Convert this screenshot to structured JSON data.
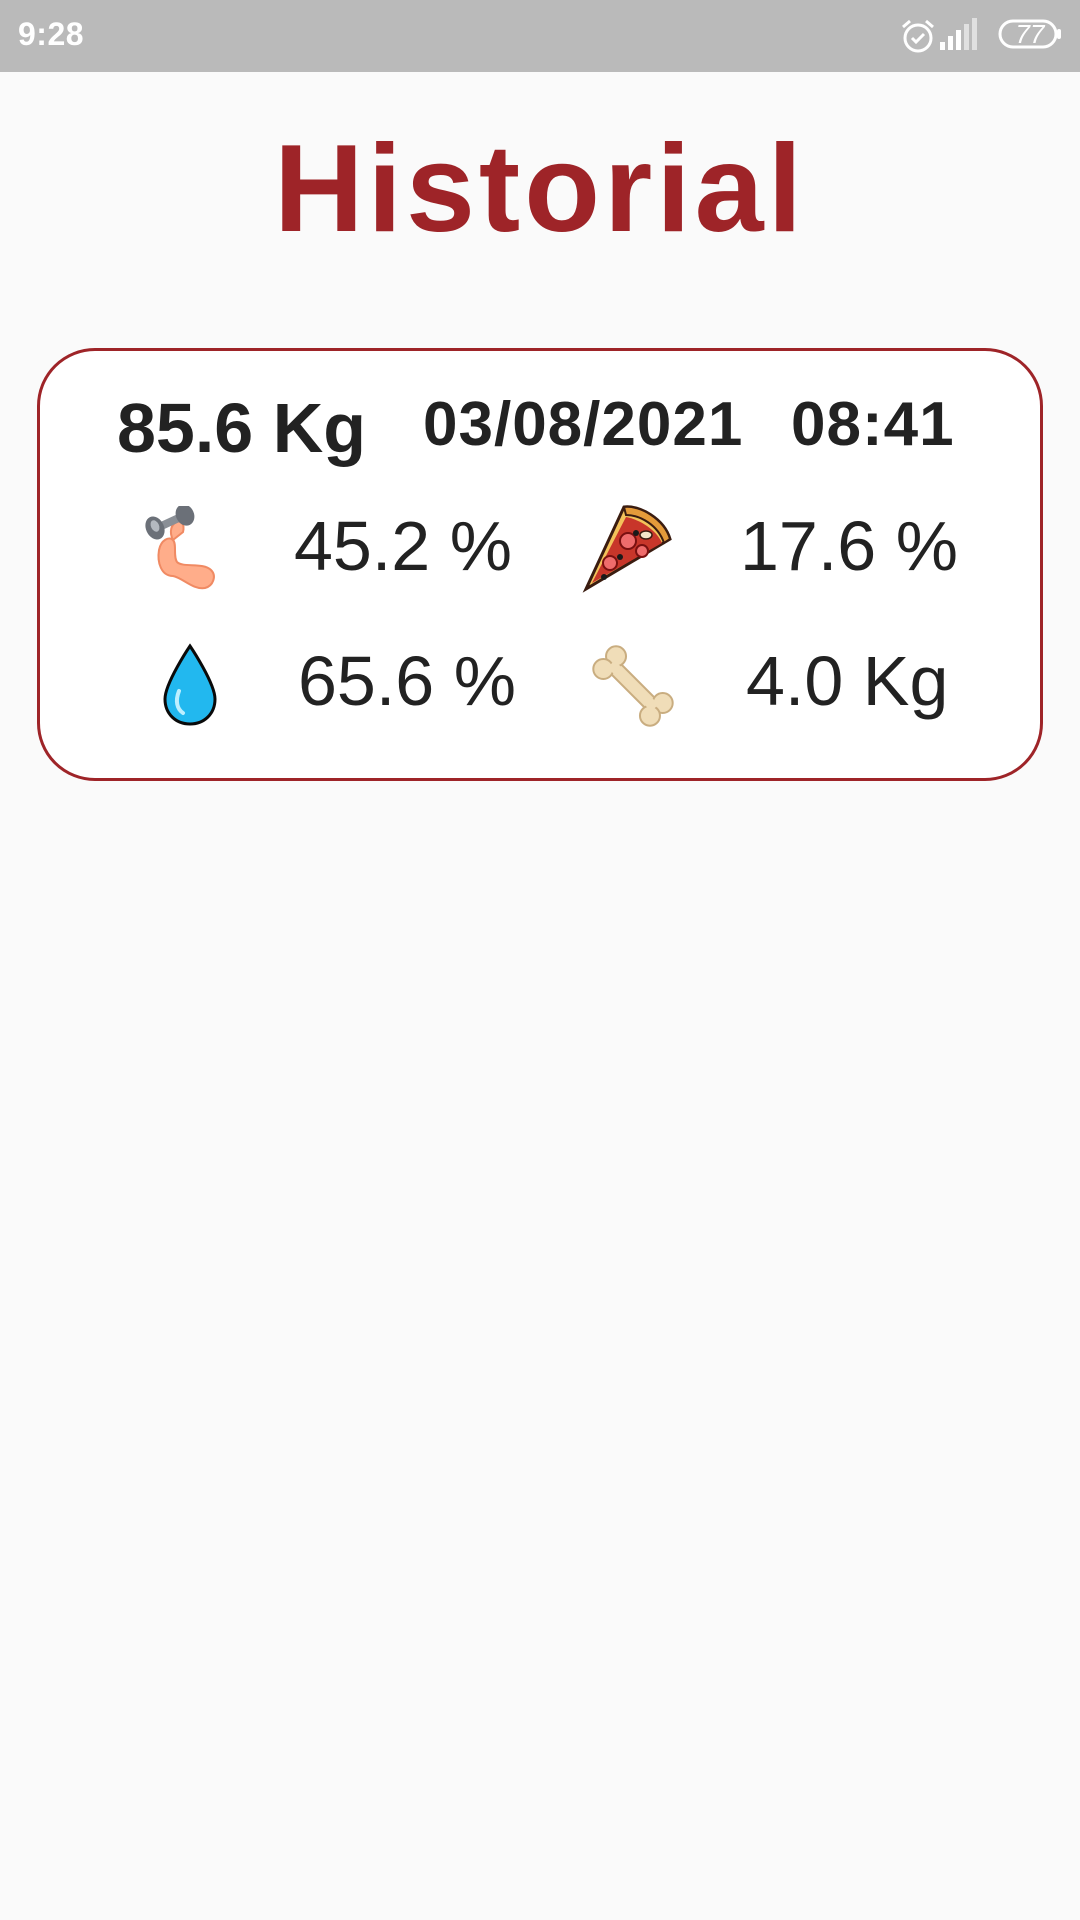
{
  "status_bar": {
    "time": "9:28",
    "battery": "77",
    "icons": [
      "alarm-icon",
      "signal-icon",
      "battery-icon"
    ]
  },
  "title": "Historial",
  "colors": {
    "accent": "#9e2428",
    "status_bar": "#bababa",
    "background": "#fafafa",
    "card": "#ffffff",
    "text": "#222222"
  },
  "history": [
    {
      "weight": "85.6 Kg",
      "date": "03/08/2021",
      "time": "08:41",
      "muscle": {
        "icon": "flexed-biceps-dumbbell-icon",
        "value": "45.2 %"
      },
      "fat": {
        "icon": "pizza-slice-icon",
        "value": "17.6 %"
      },
      "water": {
        "icon": "water-drop-icon",
        "value": "65.6 %"
      },
      "bone": {
        "icon": "bone-icon",
        "value": "4.0 Kg"
      }
    }
  ]
}
